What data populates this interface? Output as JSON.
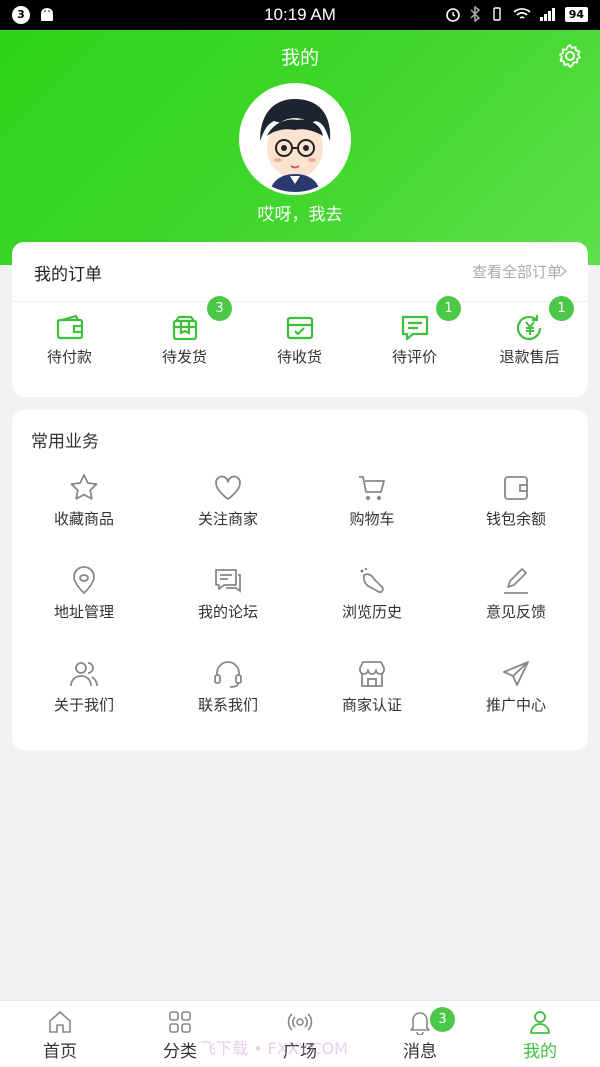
{
  "status_bar": {
    "notification_count": "3",
    "time": "10:19 AM",
    "battery": "94"
  },
  "header": {
    "title": "我的",
    "username": "哎呀，我去"
  },
  "orders": {
    "title": "我的订单",
    "view_all": "查看全部订单",
    "items": [
      {
        "label": "待付款",
        "icon": "wallet-icon",
        "badge": ""
      },
      {
        "label": "待发货",
        "icon": "box-icon",
        "badge": "3"
      },
      {
        "label": "待收货",
        "icon": "inbox-icon",
        "badge": ""
      },
      {
        "label": "待评价",
        "icon": "comment-icon",
        "badge": "1"
      },
      {
        "label": "退款售后",
        "icon": "refund-icon",
        "badge": "1"
      }
    ]
  },
  "services": {
    "title": "常用业务",
    "items": [
      {
        "label": "收藏商品",
        "icon": "star-icon"
      },
      {
        "label": "关注商家",
        "icon": "heart-icon"
      },
      {
        "label": "购物车",
        "icon": "cart-icon"
      },
      {
        "label": "钱包余额",
        "icon": "wallet-icon"
      },
      {
        "label": "地址管理",
        "icon": "location-icon"
      },
      {
        "label": "我的论坛",
        "icon": "forum-icon"
      },
      {
        "label": "浏览历史",
        "icon": "history-icon"
      },
      {
        "label": "意见反馈",
        "icon": "edit-icon"
      },
      {
        "label": "关于我们",
        "icon": "users-icon"
      },
      {
        "label": "联系我们",
        "icon": "headset-icon"
      },
      {
        "label": "商家认证",
        "icon": "store-icon"
      },
      {
        "label": "推广中心",
        "icon": "send-icon"
      }
    ]
  },
  "nav": {
    "tabs": [
      {
        "label": "首页",
        "icon": "home-icon"
      },
      {
        "label": "分类",
        "icon": "grid-icon"
      },
      {
        "label": "广场",
        "icon": "broadcast-icon"
      },
      {
        "label": "消息",
        "icon": "bell-icon",
        "badge": "3"
      },
      {
        "label": "我的",
        "icon": "user-icon"
      }
    ]
  },
  "watermark": "飞下载 • FXXY.COM",
  "colors": {
    "brand_green": "#3fd62a",
    "badge_green": "#4cc849",
    "active_tab": "#3fbf3a"
  }
}
